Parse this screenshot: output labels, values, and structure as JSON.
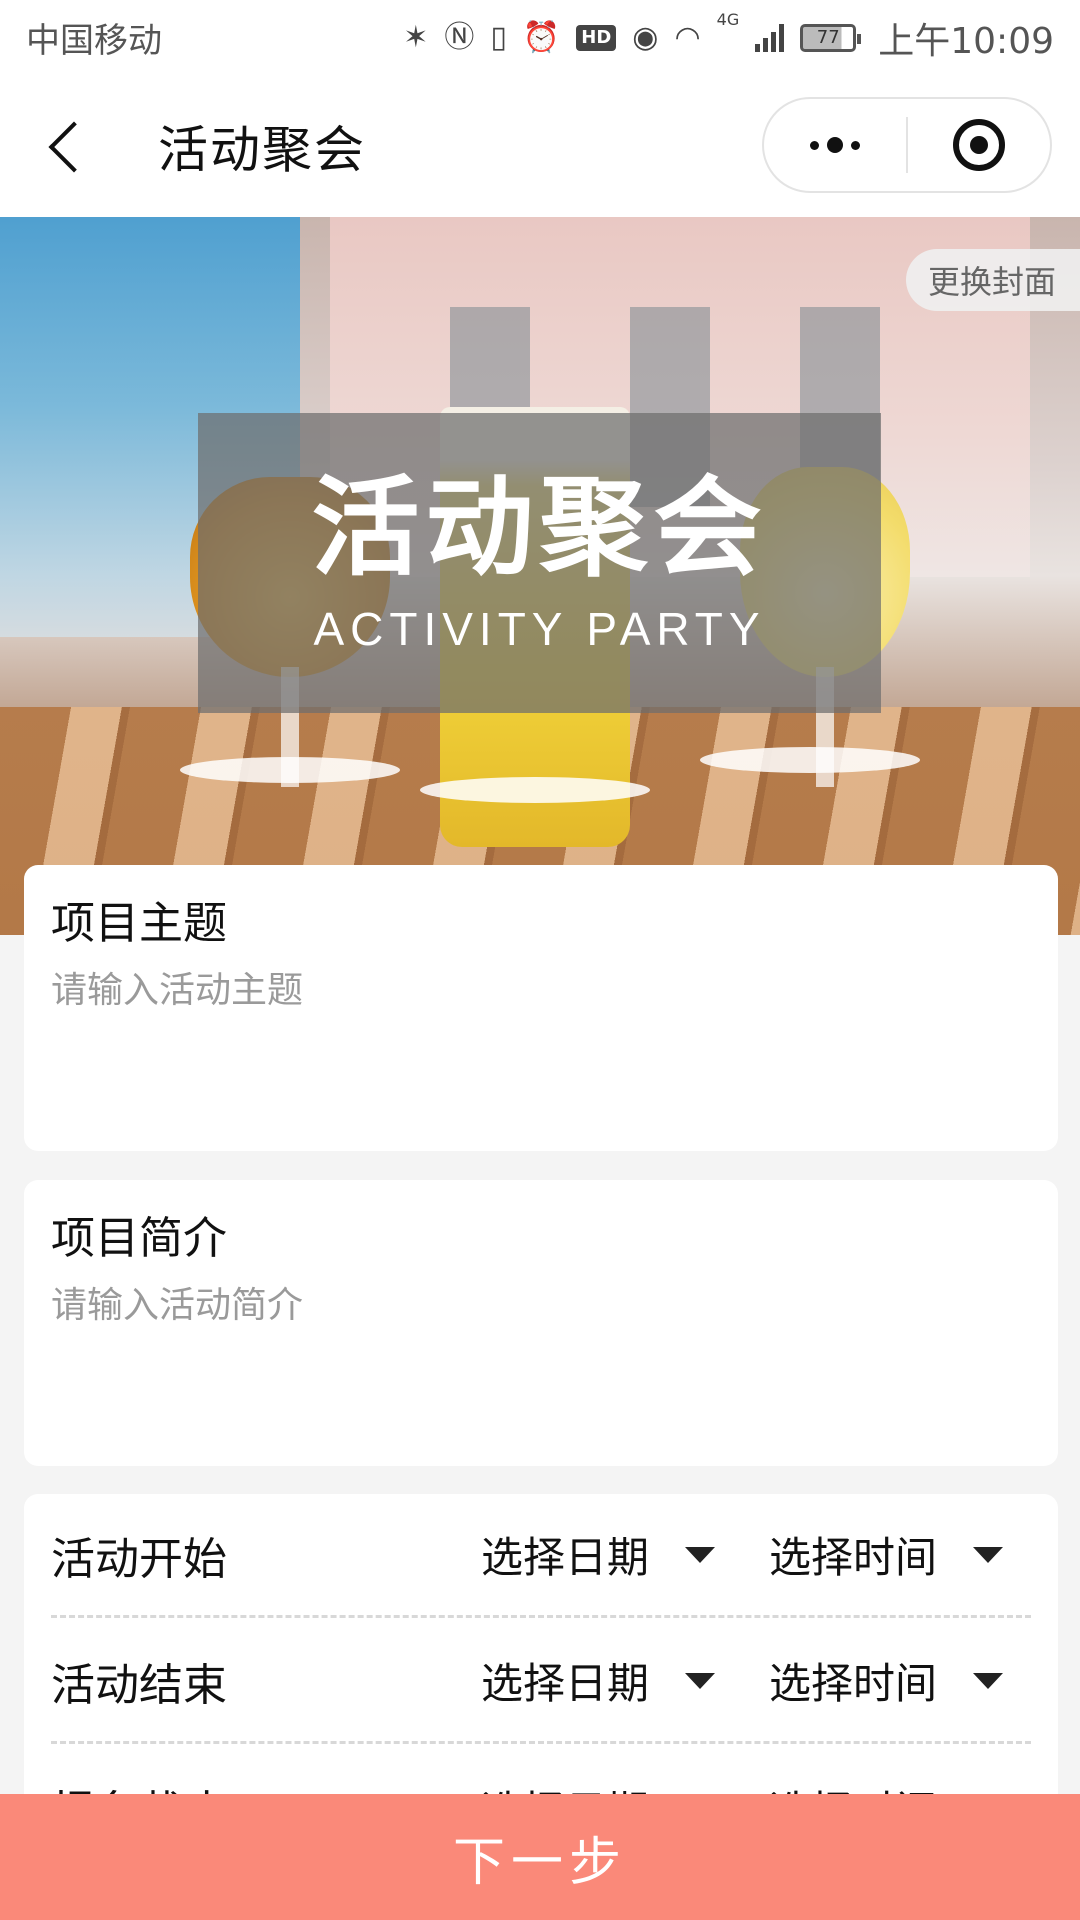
{
  "status_bar": {
    "carrier": "中国移动",
    "icons": [
      "bluetooth-icon",
      "nfc-icon",
      "vibrate-icon",
      "alarm-icon",
      "hd-icon",
      "eye-icon",
      "wifi-icon",
      "signal-icon",
      "battery-icon"
    ],
    "hd_label": "HD",
    "network_label": "4G",
    "battery_level": "77",
    "time": "上午10:09"
  },
  "nav": {
    "title": "活动聚会"
  },
  "cover": {
    "title": "活动聚会",
    "subtitle": "ACTIVITY  PARTY",
    "change_label": "更换封面"
  },
  "form": {
    "topic": {
      "label": "项目主题",
      "placeholder": "请输入活动主题",
      "value": ""
    },
    "intro": {
      "label": "项目简介",
      "placeholder": "请输入活动简介",
      "value": ""
    },
    "times": [
      {
        "label": "活动开始",
        "date_label": "选择日期",
        "time_label": "选择时间"
      },
      {
        "label": "活动结束",
        "date_label": "选择日期",
        "time_label": "选择时间"
      },
      {
        "label": "报名截止",
        "date_label": "选择日期",
        "time_label": "选择时间"
      }
    ]
  },
  "footer": {
    "next_label": "下一步"
  },
  "colors": {
    "accent": "#fa8979",
    "page_bg": "#f4f4f4",
    "card_bg": "#ffffff",
    "placeholder": "#9a9a9a"
  }
}
